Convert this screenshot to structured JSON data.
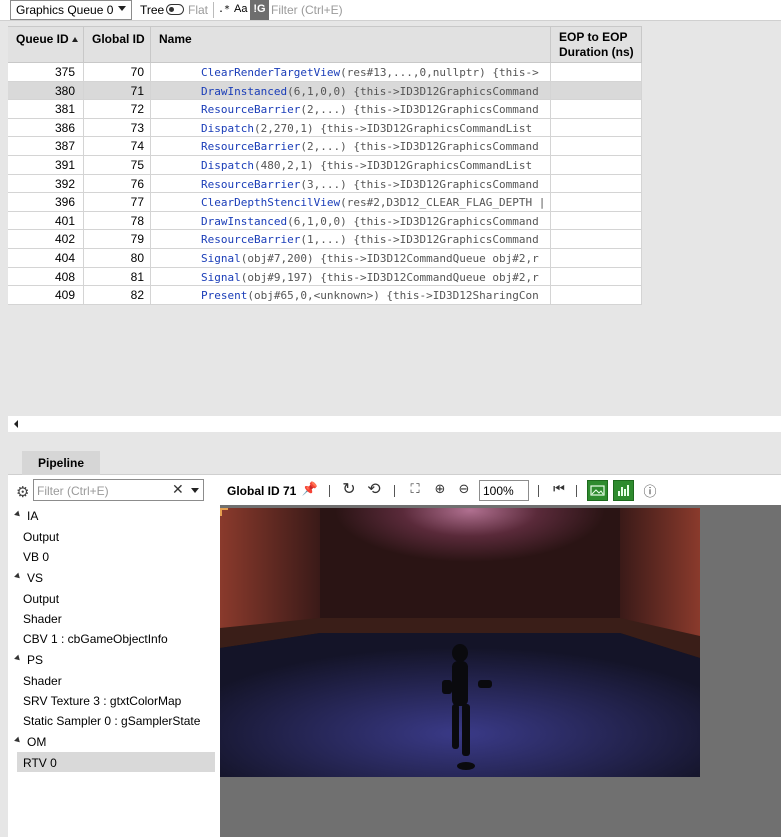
{
  "toolbar": {
    "queue_select": "Graphics Queue 0",
    "tree_label": "Tree",
    "flat_label": "Flat",
    "regex_label": ".*",
    "case_label": "Aa",
    "not_label": "!G",
    "filter_placeholder": "Filter (Ctrl+E)"
  },
  "table": {
    "columns": [
      "Queue ID",
      "Global ID",
      "Name",
      "EOP to EOP\nDuration (ns)"
    ],
    "col_queue": "Queue ID",
    "col_global": "Global ID",
    "col_name": "Name",
    "col_eop_1": "EOP to EOP",
    "col_eop_2": "Duration (ns)",
    "selected_queue_id": "380",
    "rows": [
      {
        "queue_id": "375",
        "global_id": "70",
        "fn": "ClearRenderTargetView",
        "args": "(res#13,...,0,nullptr)  {this->"
      },
      {
        "queue_id": "380",
        "global_id": "71",
        "fn": "DrawInstanced",
        "args": "(6,1,0,0)  {this->ID3D12GraphicsCommand"
      },
      {
        "queue_id": "381",
        "global_id": "72",
        "fn": "ResourceBarrier",
        "args": "(2,...)  {this->ID3D12GraphicsCommand"
      },
      {
        "queue_id": "386",
        "global_id": "73",
        "fn": "Dispatch",
        "args": "(2,270,1)  {this->ID3D12GraphicsCommandList"
      },
      {
        "queue_id": "387",
        "global_id": "74",
        "fn": "ResourceBarrier",
        "args": "(2,...)  {this->ID3D12GraphicsCommand"
      },
      {
        "queue_id": "391",
        "global_id": "75",
        "fn": "Dispatch",
        "args": "(480,2,1)  {this->ID3D12GraphicsCommandList"
      },
      {
        "queue_id": "392",
        "global_id": "76",
        "fn": "ResourceBarrier",
        "args": "(3,...)  {this->ID3D12GraphicsCommand"
      },
      {
        "queue_id": "396",
        "global_id": "77",
        "fn": "ClearDepthStencilView",
        "args": "(res#2,D3D12_CLEAR_FLAG_DEPTH |"
      },
      {
        "queue_id": "401",
        "global_id": "78",
        "fn": "DrawInstanced",
        "args": "(6,1,0,0)  {this->ID3D12GraphicsCommand"
      },
      {
        "queue_id": "402",
        "global_id": "79",
        "fn": "ResourceBarrier",
        "args": "(1,...)  {this->ID3D12GraphicsCommand"
      },
      {
        "queue_id": "404",
        "global_id": "80",
        "fn": "Signal",
        "args": "(obj#7,200)  {this->ID3D12CommandQueue obj#2,r"
      },
      {
        "queue_id": "408",
        "global_id": "81",
        "fn": "Signal",
        "args": "(obj#9,197)  {this->ID3D12CommandQueue obj#2,r"
      },
      {
        "queue_id": "409",
        "global_id": "82",
        "fn": "Present",
        "args": "(obj#65,0,<unknown>)  {this->ID3D12SharingCon"
      }
    ]
  },
  "pipeline": {
    "tab_label": "Pipeline",
    "filter_placeholder": "Filter (Ctrl+E)",
    "global_id_label": "Global ID 71",
    "zoom": "100%",
    "stages": [
      {
        "name": "IA",
        "items": [
          "Output",
          "VB 0"
        ]
      },
      {
        "name": "VS",
        "items": [
          "Output",
          "Shader",
          "CBV 1 : cbGameObjectInfo"
        ]
      },
      {
        "name": "PS",
        "items": [
          "Shader",
          "SRV Texture 3 : gtxtColorMap",
          "Static Sampler 0 : gSamplerState"
        ]
      },
      {
        "name": "OM",
        "items": [
          "RTV 0"
        ]
      }
    ],
    "selected_item": "RTV 0"
  },
  "icons": [
    "chevron-down-icon",
    "toggle-icon",
    "gear-icon",
    "clear-icon",
    "pin-icon",
    "reset-icon",
    "history-icon",
    "fit-icon",
    "zoom-in-icon",
    "zoom-out-icon",
    "first-frame-icon",
    "image-view-icon",
    "histogram-icon",
    "info-icon"
  ],
  "colors": {
    "function_name": "#1a3db8",
    "accent_green": "#2e8b2e",
    "selection": "#d9d9d9"
  }
}
